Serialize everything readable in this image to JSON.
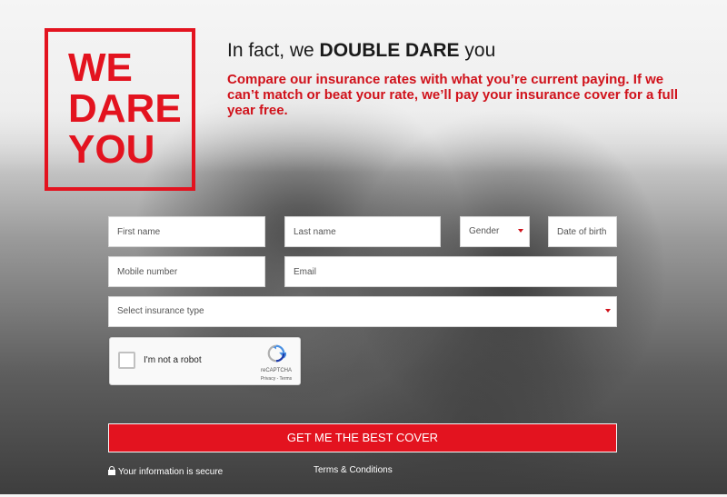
{
  "logo": {
    "lines": [
      "WE",
      "DARE",
      "YOU"
    ]
  },
  "headline": {
    "prefix": "In fact, we ",
    "emphasis": "DOUBLE DARE",
    "suffix": " you"
  },
  "subline": "Compare our insurance rates with what you’re current paying. If we can’t match or beat your rate, we’ll pay your insurance cover for a full year free.",
  "form": {
    "first_name": {
      "placeholder": "First name",
      "value": ""
    },
    "last_name": {
      "placeholder": "Last name",
      "value": ""
    },
    "gender": {
      "selected": "Gender"
    },
    "dob": {
      "placeholder": "Date of birth",
      "value": ""
    },
    "mobile": {
      "placeholder": "Mobile number",
      "value": ""
    },
    "email": {
      "placeholder": "Email",
      "value": ""
    },
    "insurance_type": {
      "selected": "Select insurance type"
    },
    "captcha": {
      "label": "I'm not a robot",
      "brand": "reCAPTCHA",
      "links": "Privacy - Terms"
    },
    "submit_label": "GET ME THE BEST COVER"
  },
  "footer": {
    "secure_text": "Your information is secure",
    "terms_link": "Terms & Conditions"
  },
  "colors": {
    "brand_red": "#e3131f",
    "text_red": "#d0121b"
  },
  "icons": [
    "lock-icon",
    "recaptcha-icon",
    "caret-down-icon"
  ]
}
